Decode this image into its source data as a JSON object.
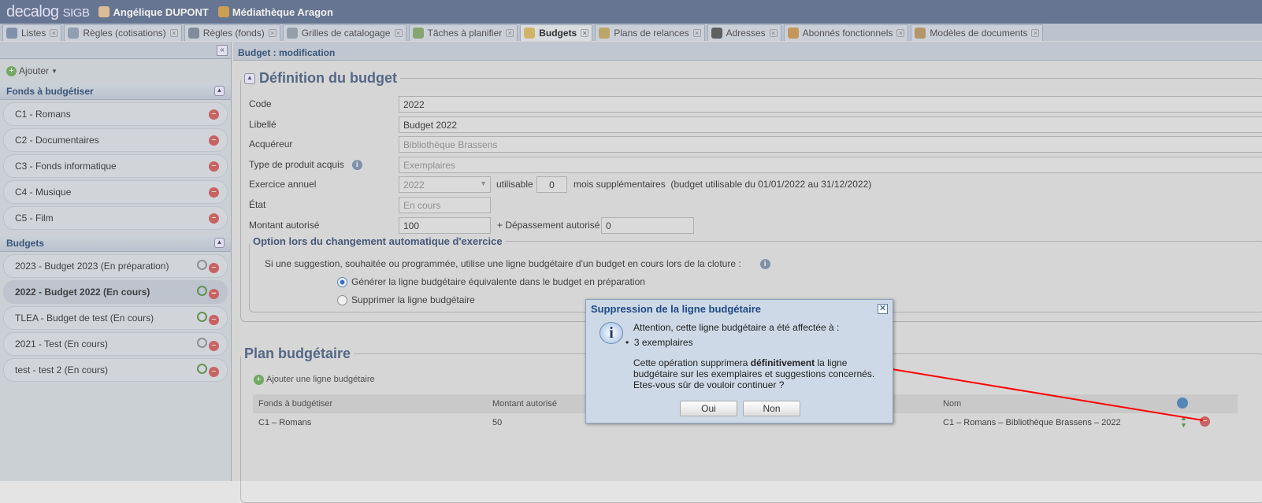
{
  "header": {
    "logo": "decalog",
    "logo_suffix": "SIGB",
    "user": "Angélique DUPONT",
    "library": "Médiathèque Aragon"
  },
  "tabs": [
    {
      "label": "Listes"
    },
    {
      "label": "Règles (cotisations)"
    },
    {
      "label": "Règles (fonds)"
    },
    {
      "label": "Grilles de catalogage"
    },
    {
      "label": "Tâches à planifier"
    },
    {
      "label": "Budgets",
      "active": true
    },
    {
      "label": "Plans de relances"
    },
    {
      "label": "Adresses"
    },
    {
      "label": "Abonnés fonctionnels"
    },
    {
      "label": "Modèles de documents"
    }
  ],
  "sidebar": {
    "add_label": "Ajouter",
    "funds_title": "Fonds à budgétiser",
    "funds": [
      "C1 - Romans",
      "C2 - Documentaires",
      "C3 - Fonds informatique",
      "C4 - Musique",
      "C5 - Film"
    ],
    "budgets_title": "Budgets",
    "budgets": [
      {
        "label": "2023 - Budget 2023 (En préparation)"
      },
      {
        "label": "2022 - Budget 2022 (En cours)",
        "selected": true
      },
      {
        "label": "TLEA - Budget de test (En cours)"
      },
      {
        "label": "2021 - Test (En cours)"
      },
      {
        "label": "test - test 2 (En cours)"
      }
    ]
  },
  "main": {
    "subtitle": "Budget : modification",
    "definition_title": "Définition du budget",
    "fields": {
      "code_label": "Code",
      "code": "2022",
      "libelle_label": "Libellé",
      "libelle": "Budget 2022",
      "acquereur_label": "Acquéreur",
      "acquereur": "Bibliothèque Brassens",
      "type_label": "Type de produit acquis",
      "type": "Exemplaires",
      "exercice_label": "Exercice annuel",
      "exercice": "2022",
      "utilisable_label": "utilisable",
      "utilisable": "0",
      "mois_label": "mois supplémentaires  (budget utilisable du 01/01/2022 au 31/12/2022)",
      "etat_label": "État",
      "etat": "En cours",
      "montant_label": "Montant autorisé",
      "montant": "100",
      "depassement_label": "+ Dépassement autorisé",
      "depassement": "0"
    },
    "option_title": "Option lors du changement automatique d'exercice",
    "option_text": "Si une suggestion, souhaitée ou programmée, utilise une ligne budgétaire d'un budget en cours lors de la cloture :",
    "radio1": "Générer la ligne budgétaire équivalente dans le budget en préparation",
    "radio2": "Supprimer la ligne budgétaire",
    "plan_title": "Plan budgétaire",
    "add_line": "Ajouter une ligne budgétaire",
    "columns": [
      "Fonds à budgétiser",
      "Montant autorisé",
      "Nom"
    ],
    "rows": [
      {
        "fonds": "C1 – Romans",
        "montant": "50",
        "nom": "C1 – Romans – Bibliothèque Brassens – 2022"
      }
    ]
  },
  "dialog": {
    "title": "Suppression de la ligne budgétaire",
    "line1": "Attention, cette ligne budgétaire a été affectée à :",
    "bullet": "3 exemplaires",
    "p_before": "Cette opération supprimera ",
    "p_bold": "définitivement",
    "p_after": " la ligne budgétaire sur les exemplaires et suggestions concernés.",
    "question": "Etes-vous sûr de vouloir continuer ?",
    "yes": "Oui",
    "no": "Non"
  },
  "colors": {
    "header": "#6d7d9b",
    "arrow": "#ff0000"
  }
}
